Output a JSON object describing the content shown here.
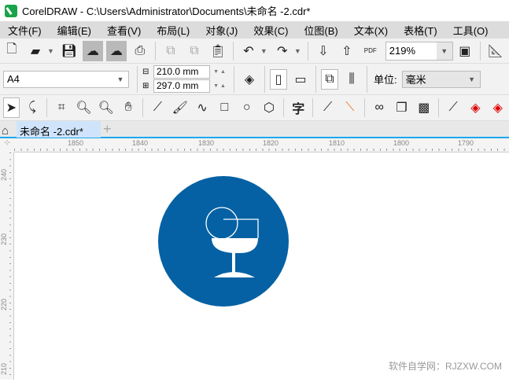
{
  "window": {
    "title": "CorelDRAW - C:\\Users\\Administrator\\Documents\\未命名 -2.cdr*"
  },
  "menu": [
    "文件(F)",
    "编辑(E)",
    "查看(V)",
    "布局(L)",
    "对象(J)",
    "效果(C)",
    "位图(B)",
    "文本(X)",
    "表格(T)",
    "工具(O)"
  ],
  "toolbar": {
    "zoom": "219%",
    "pdf_label": "PDF"
  },
  "property_bar": {
    "page_size": "A4",
    "width": "210.0 mm",
    "height": "297.0 mm",
    "units_label": "单位:",
    "units": "毫米"
  },
  "toolbox": {
    "text_tool": "字"
  },
  "tabs": {
    "document": "未命名 -2.cdr*",
    "add": "+"
  },
  "rulers": {
    "horizontal": [
      "1850",
      "1840",
      "1830",
      "1820",
      "1810",
      "1800",
      "1790"
    ],
    "vertical": [
      "240",
      "230",
      "220",
      "210"
    ]
  },
  "artwork": {
    "circle_color": "#0561a4",
    "glyph_color": "#ffffff"
  },
  "watermark": "软件自学网：RJZXW.COM"
}
